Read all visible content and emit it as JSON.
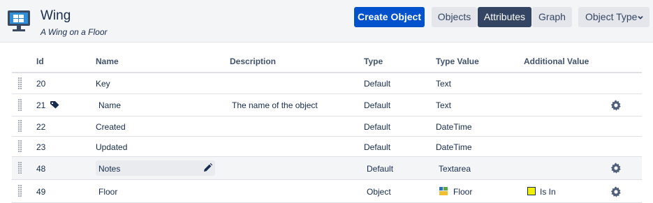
{
  "object": {
    "title": "Wing",
    "subtitle": "A Wing on a Floor",
    "icon": "monitor-icon"
  },
  "toolbar": {
    "create_label": "Create Object",
    "objects_label": "Objects",
    "attributes_label": "Attributes",
    "graph_label": "Graph",
    "object_type_label": "Object Type",
    "active_tab": "Attributes"
  },
  "table": {
    "headers": {
      "id": "Id",
      "name": "Name",
      "description": "Description",
      "type": "Type",
      "type_value": "Type Value",
      "additional_value": "Additional Value"
    },
    "rows": [
      {
        "id": "20",
        "name": "Key",
        "description": "",
        "type": "Default",
        "type_value": "Text",
        "additional_value": ""
      },
      {
        "id": "21",
        "name": "Name",
        "description": "The name of the object",
        "type": "Default",
        "type_value": "Text",
        "additional_value": ""
      },
      {
        "id": "22",
        "name": "Created",
        "description": "",
        "type": "Default",
        "type_value": "DateTime",
        "additional_value": ""
      },
      {
        "id": "23",
        "name": "Updated",
        "description": "",
        "type": "Default",
        "type_value": "DateTime",
        "additional_value": ""
      },
      {
        "id": "48",
        "name": "Notes",
        "description": "",
        "type": "Default",
        "type_value": "Textarea",
        "additional_value": ""
      },
      {
        "id": "49",
        "name": "Floor",
        "description": "",
        "type": "Object",
        "type_value": "Floor",
        "additional_value": "Is In"
      }
    ]
  },
  "colors": {
    "primary": "#0052cc",
    "active_tab": "#344563",
    "swatch": "#f0f000"
  }
}
